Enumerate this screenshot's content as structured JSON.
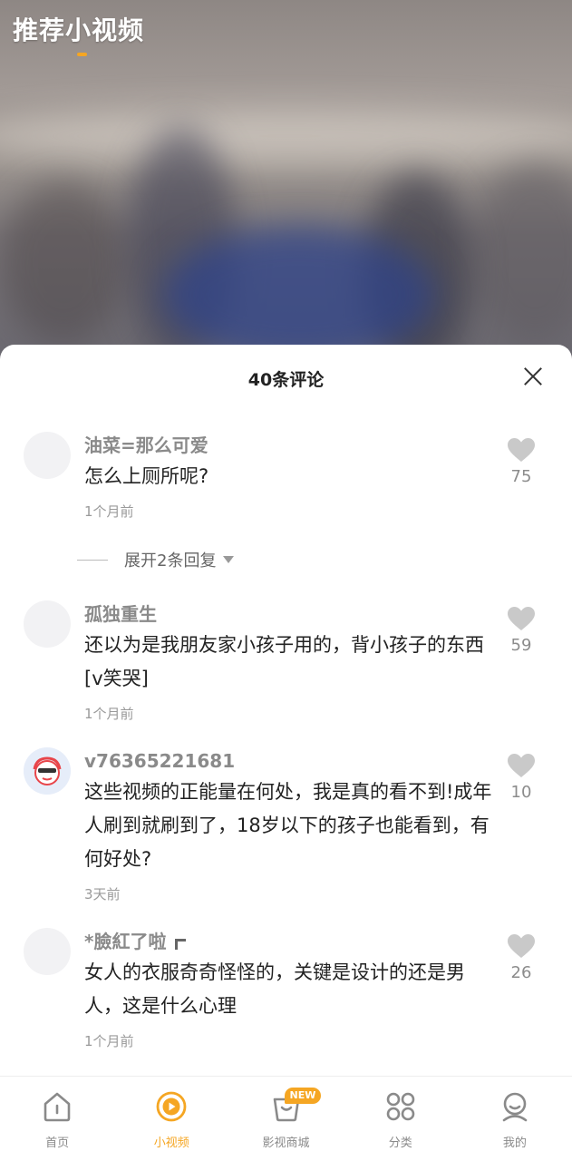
{
  "header": {
    "title": "推荐小视频"
  },
  "panel": {
    "title": "40条评论",
    "expand_label": "展开2条回复",
    "comments": [
      {
        "user": "油菜=那么可爱",
        "text": "怎么上厕所呢?",
        "time": "1个月前",
        "likes": "75"
      },
      {
        "user": "孤独重生",
        "text": "还以为是我朋友家小孩子用的，背小孩子的东西[v笑哭]",
        "time": "1个月前",
        "likes": "59"
      },
      {
        "user": "v76365221681",
        "text": "这些视频的正能量在何处，我是真的看不到!成年人刷到就刷到了，18岁以下的孩子也能看到，有何好处?",
        "time": "3天前",
        "likes": "10"
      },
      {
        "user": "*臉紅了啦",
        "text": "女人的衣服奇奇怪怪的，关键是设计的还是男人，这是什么心理",
        "time": "1个月前",
        "likes": "26"
      }
    ]
  },
  "nav": {
    "items": [
      {
        "label": "首页",
        "icon": "home-icon"
      },
      {
        "label": "小视频",
        "icon": "play-circle-icon"
      },
      {
        "label": "影视商城",
        "icon": "tv-icon",
        "badge": "NEW"
      },
      {
        "label": "分类",
        "icon": "grid-icon"
      },
      {
        "label": "我的",
        "icon": "profile-icon"
      }
    ]
  },
  "colors": {
    "accent": "#f5a623",
    "text": "#222222",
    "muted": "#8a8a8a"
  }
}
